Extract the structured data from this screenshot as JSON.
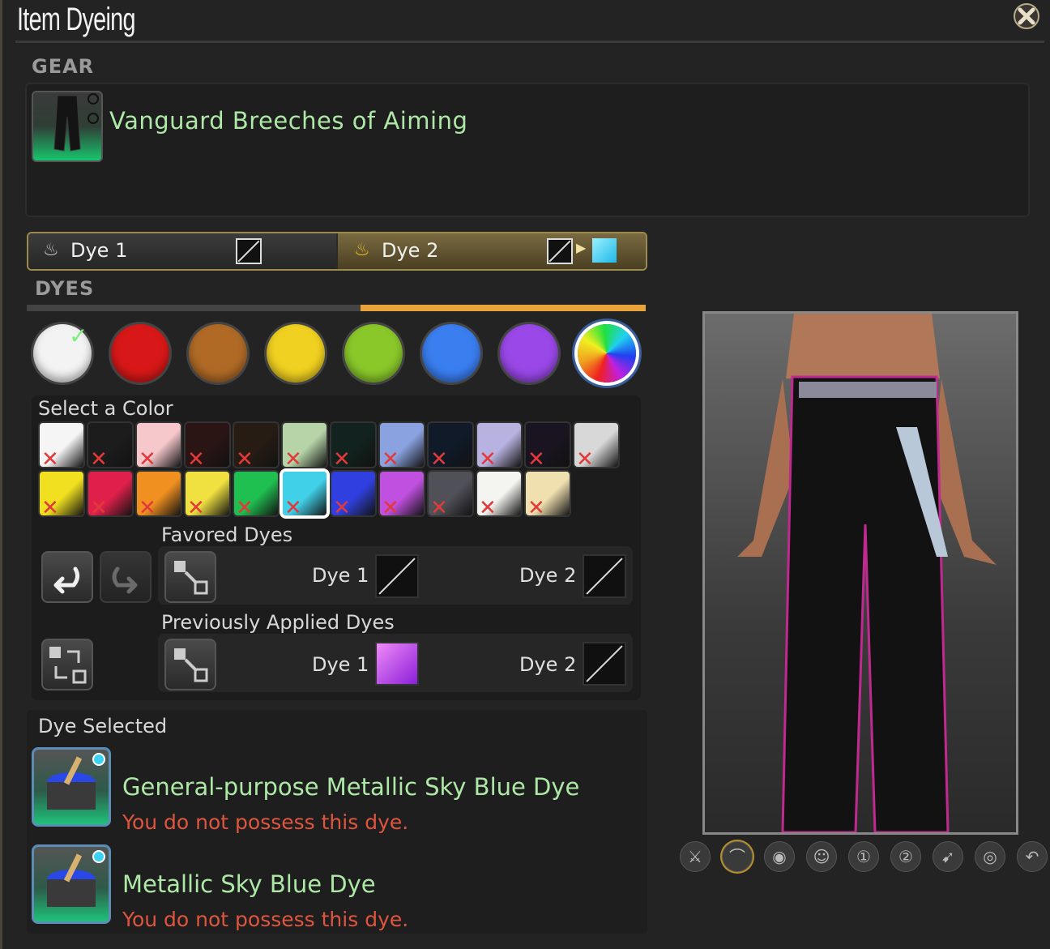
{
  "window": {
    "title": "Item Dyeing"
  },
  "gear_section": {
    "label": "GEAR",
    "item_name": "Vanguard Breeches of Aiming"
  },
  "tabs": [
    {
      "label": "Dye 1"
    },
    {
      "label": "Dye 2"
    }
  ],
  "dyes_section": {
    "label": "DYES"
  },
  "dye_categories": [
    {
      "color": "#f3f3f3",
      "selected": true
    },
    {
      "color": "#d81818"
    },
    {
      "color": "#b06a26"
    },
    {
      "color": "#f0d020"
    },
    {
      "color": "#8ac82a"
    },
    {
      "color": "#3a7ef0"
    },
    {
      "color": "#9a48e8"
    },
    {
      "color": "rainbow"
    }
  ],
  "select_color": {
    "label": "Select a Color",
    "row1": [
      "#f5f5f5",
      "#1c1c1c",
      "#f6c8cc",
      "#2a1414",
      "#261c14",
      "#b6d4a8",
      "#12221e",
      "#8aa2e0",
      "#101a28",
      "#b8b2e0",
      "#1a1420",
      "#d8d8d8"
    ],
    "row2": [
      "#f0e020",
      "#e0204a",
      "#f09020",
      "#f0e040",
      "#20c050",
      "#40d0e8",
      "#3040e0",
      "#c050e0",
      "#505058",
      "#f4f4f0",
      "#f0e0b0"
    ],
    "selected_index_row2": 5
  },
  "favored": {
    "label": "Favored Dyes",
    "dye1_label": "Dye 1",
    "dye2_label": "Dye 2"
  },
  "previous": {
    "label": "Previously Applied Dyes",
    "dye1_label": "Dye 1",
    "dye2_label": "Dye 2",
    "dye1_color": "#c04ae0"
  },
  "dye_selected": {
    "label": "Dye Selected",
    "items": [
      {
        "name": "General-purpose Metallic Sky Blue Dye",
        "status": "You do not possess this dye."
      },
      {
        "name": "Metallic Sky Blue Dye",
        "status": "You do not possess this dye."
      }
    ]
  },
  "preview_controls": [
    "weapon-icon",
    "headgear-icon",
    "visor-icon",
    "figure-icon",
    "dye-1-icon",
    "dye-2-icon",
    "pose-icon",
    "eye-icon",
    "reset-icon"
  ]
}
